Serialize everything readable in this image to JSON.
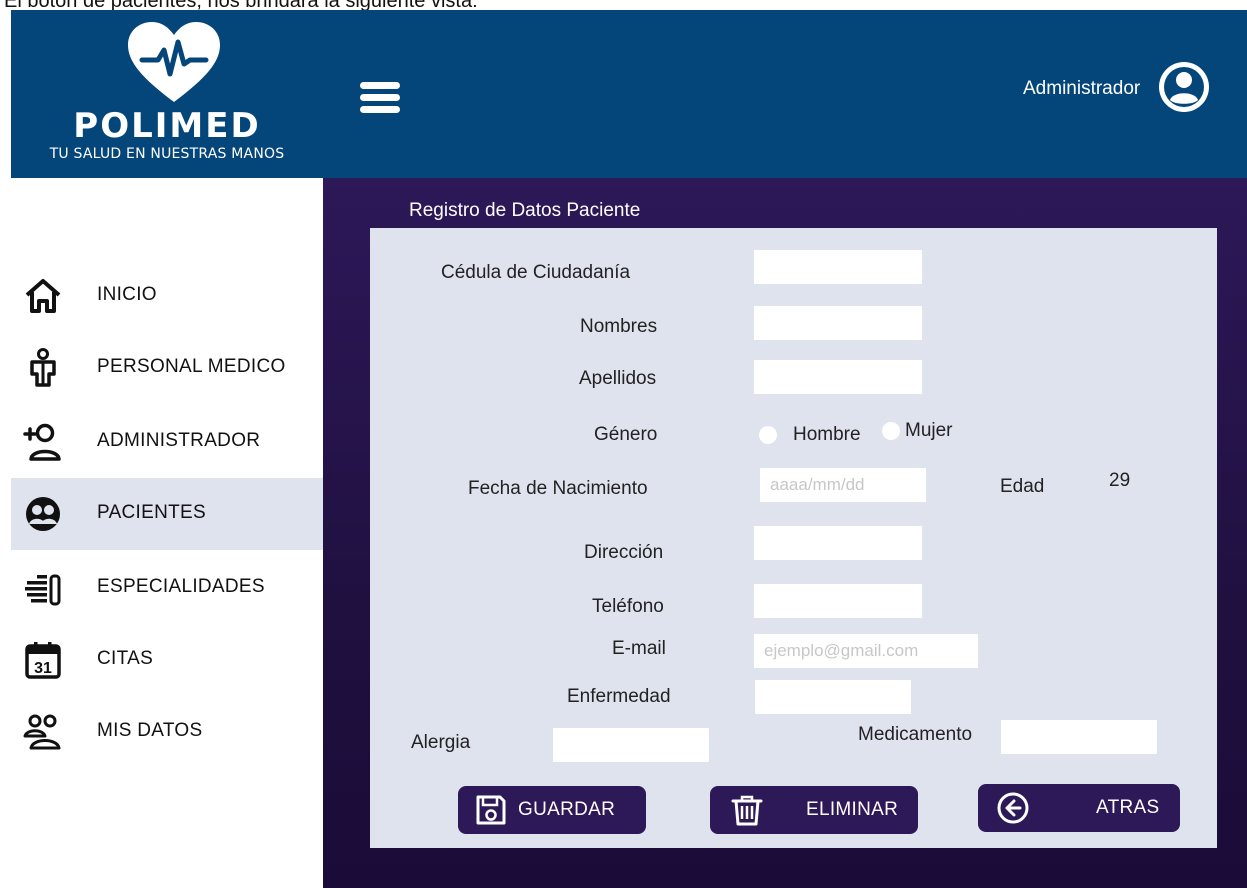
{
  "caption": "El botón de pacientes, nos brindará la siguiente vista:",
  "brand": {
    "name": "POLIMED",
    "tagline": "TU SALUD EN NUESTRAS MANOS"
  },
  "header": {
    "user_label": "Administrador"
  },
  "sidebar": {
    "items": [
      {
        "label": "INICIO",
        "icon": "home-icon"
      },
      {
        "label": "PERSONAL MEDICO",
        "icon": "doctor-icon"
      },
      {
        "label": "ADMINISTRADOR",
        "icon": "add-user-icon"
      },
      {
        "label": "PACIENTES",
        "icon": "patients-icon",
        "active": true
      },
      {
        "label": "ESPECIALIDADES",
        "icon": "specialties-icon"
      },
      {
        "label": "CITAS",
        "icon": "calendar-icon"
      },
      {
        "label": "MIS DATOS",
        "icon": "group-icon"
      }
    ],
    "calendar_day": "31"
  },
  "form": {
    "title": "Registro de Datos Paciente",
    "fields": {
      "cedula": {
        "label": "Cédula de Ciudadanía",
        "value": ""
      },
      "nombres": {
        "label": "Nombres",
        "value": ""
      },
      "apellidos": {
        "label": "Apellidos",
        "value": ""
      },
      "genero": {
        "label": "Género",
        "options": [
          "Hombre",
          "Mujer"
        ]
      },
      "fecha": {
        "label": "Fecha de Nacimiento",
        "placeholder": "aaaa/mm/dd"
      },
      "edad": {
        "label": "Edad",
        "value": "29"
      },
      "direccion": {
        "label": "Dirección",
        "value": ""
      },
      "telefono": {
        "label": "Teléfono",
        "value": ""
      },
      "email": {
        "label": "E-mail",
        "placeholder": "ejemplo@gmail.com"
      },
      "enfermedad": {
        "label": "Enfermedad",
        "value": ""
      },
      "alergia": {
        "label": "Alergia",
        "value": ""
      },
      "medicamento": {
        "label": "Medicamento",
        "value": ""
      }
    },
    "buttons": {
      "save": "GUARDAR",
      "delete": "ELIMINAR",
      "back": "ATRAS"
    }
  },
  "colors": {
    "header_bg": "#05467a",
    "main_bg": "#2d1858",
    "panel_bg": "#dfe3ee",
    "active_nav_bg": "#dfe3ee",
    "button_bg": "#2d1858"
  }
}
